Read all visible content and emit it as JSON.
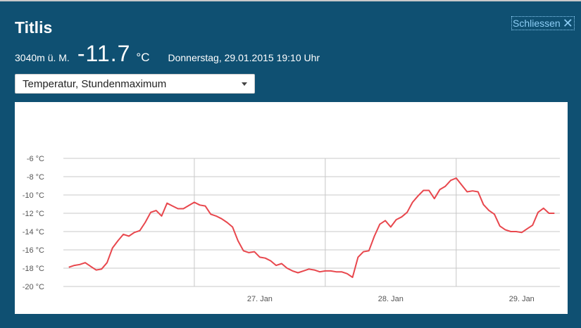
{
  "header": {
    "title": "Titlis",
    "close_label": "Schliessen",
    "close_icon": "close-icon",
    "altitude": "3040m ü. M.",
    "temperature": "-11.7",
    "unit": "°C",
    "datetime": "Donnerstag, 29.01.2015 19:10 Uhr"
  },
  "selector": {
    "selected": "Temperatur, Stundenmaximum"
  },
  "chart_data": {
    "type": "line",
    "title": "",
    "xlabel": "",
    "ylabel": "",
    "series": [
      {
        "name": "Temperatur, Stundenmaximum",
        "color": "#e8474d",
        "x_start_hour": 1,
        "x_step_hours": 1,
        "values": [
          -17.9,
          -17.7,
          -17.6,
          -17.4,
          -17.8,
          -18.2,
          -18.1,
          -17.4,
          -15.8,
          -15.0,
          -14.3,
          -14.5,
          -14.1,
          -13.9,
          -13.0,
          -11.9,
          -11.7,
          -12.3,
          -10.9,
          -11.2,
          -11.5,
          -11.5,
          -11.15,
          -10.8,
          -11.1,
          -11.2,
          -12.1,
          -12.3,
          -12.6,
          -13.0,
          -13.5,
          -15.0,
          -16.1,
          -16.3,
          -16.2,
          -16.8,
          -16.9,
          -17.2,
          -17.7,
          -17.5,
          -18.0,
          -18.3,
          -18.5,
          -18.3,
          -18.1,
          -18.2,
          -18.4,
          -18.3,
          -18.3,
          -18.4,
          -18.4,
          -18.6,
          -19.0,
          -16.8,
          -16.2,
          -16.1,
          -14.5,
          -13.2,
          -12.8,
          -13.5,
          -12.7,
          -12.4,
          -11.9,
          -10.8,
          -10.1,
          -9.5,
          -9.5,
          -10.4,
          -9.4,
          -9.05,
          -8.4,
          -8.15,
          -8.9,
          -9.65,
          -9.55,
          -9.65,
          -11.05,
          -11.7,
          -12.1,
          -13.4,
          -13.8,
          -14.0,
          -14.0,
          -14.1,
          -13.7,
          -13.3,
          -11.9,
          -11.45,
          -12.0,
          -12.0
        ]
      }
    ],
    "x_unit": "hours since 26. Jan 00:00",
    "xlim": [
      0,
      91
    ],
    "ylim": [
      -20,
      -6
    ],
    "yticks": [
      -6,
      -8,
      -10,
      -12,
      -14,
      -16,
      -18,
      -20
    ],
    "ytick_labels": [
      "-6 °C",
      "-8 °C",
      "-10 °C",
      "-12 °C",
      "-14 °C",
      "-16 °C",
      "-18 °C",
      "-20 °C"
    ],
    "x_gridlines": [
      24,
      48,
      72
    ],
    "xticks": [
      36,
      60,
      84
    ],
    "xtick_labels": [
      "27. Jan",
      "28. Jan",
      "29. Jan"
    ],
    "grid": true,
    "legend": "none"
  }
}
